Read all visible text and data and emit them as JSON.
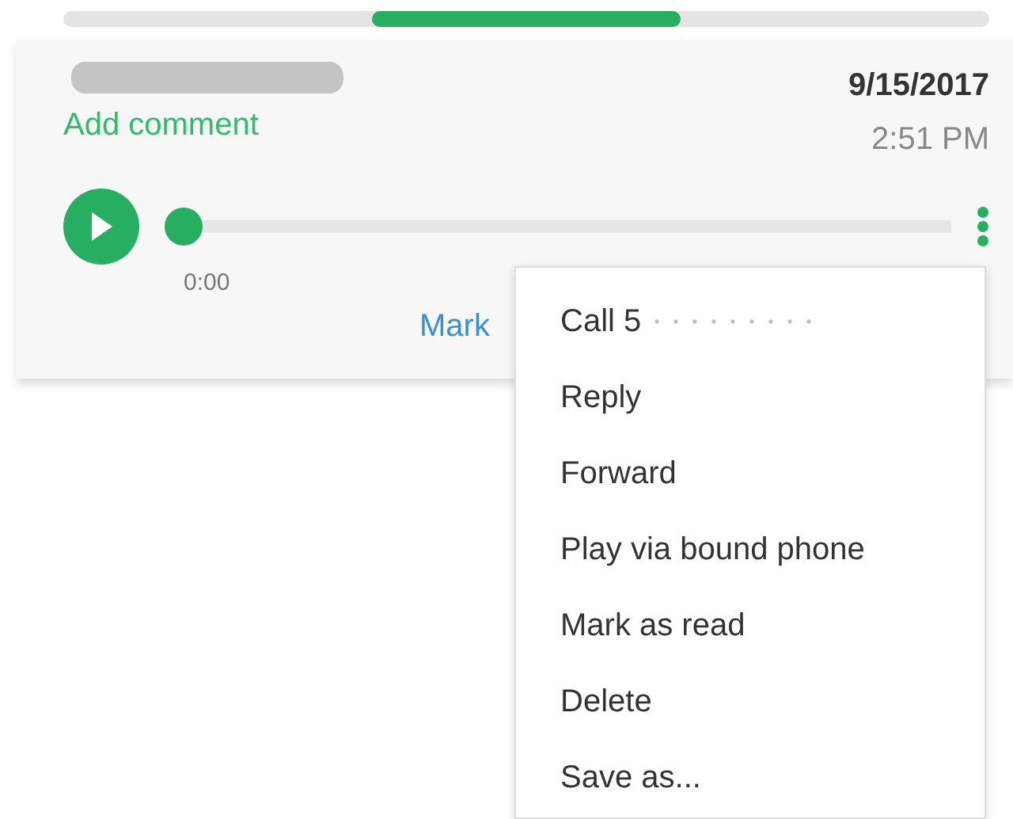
{
  "message": {
    "add_comment": "Add comment",
    "date": "9/15/2017",
    "time": "2:51 PM",
    "player": {
      "level": 0,
      "elapsed": "0:00"
    },
    "mark_link": "Mark"
  },
  "menu": {
    "items": [
      {
        "label": "Call 5",
        "redacted_suffix": true
      },
      {
        "label": "Reply",
        "redacted_suffix": false
      },
      {
        "label": "Forward",
        "redacted_suffix": false
      },
      {
        "label": "Play via bound phone",
        "redacted_suffix": false
      },
      {
        "label": "Mark as read",
        "redacted_suffix": false
      },
      {
        "label": "Delete",
        "redacted_suffix": false
      },
      {
        "label": "Save as...",
        "redacted_suffix": false
      }
    ]
  }
}
